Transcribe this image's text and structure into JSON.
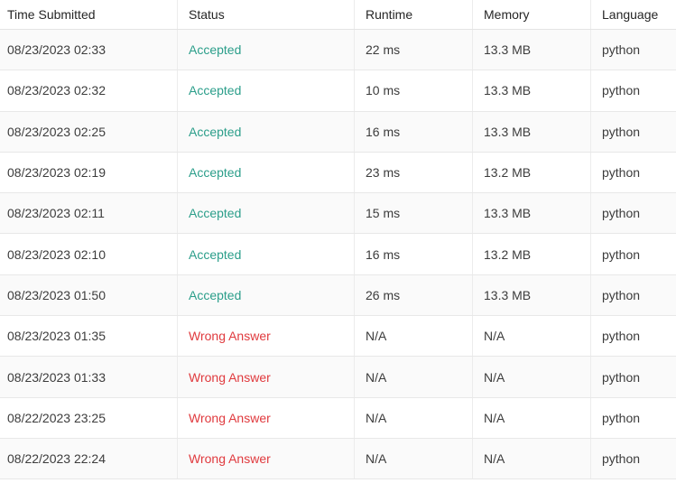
{
  "table": {
    "headers": {
      "time": "Time Submitted",
      "status": "Status",
      "runtime": "Runtime",
      "memory": "Memory",
      "language": "Language"
    },
    "rows": [
      {
        "time": "08/23/2023 02:33",
        "status": "Accepted",
        "runtime": "22 ms",
        "memory": "13.3 MB",
        "language": "python"
      },
      {
        "time": "08/23/2023 02:32",
        "status": "Accepted",
        "runtime": "10 ms",
        "memory": "13.3 MB",
        "language": "python"
      },
      {
        "time": "08/23/2023 02:25",
        "status": "Accepted",
        "runtime": "16 ms",
        "memory": "13.3 MB",
        "language": "python"
      },
      {
        "time": "08/23/2023 02:19",
        "status": "Accepted",
        "runtime": "23 ms",
        "memory": "13.2 MB",
        "language": "python"
      },
      {
        "time": "08/23/2023 02:11",
        "status": "Accepted",
        "runtime": "15 ms",
        "memory": "13.3 MB",
        "language": "python"
      },
      {
        "time": "08/23/2023 02:10",
        "status": "Accepted",
        "runtime": "16 ms",
        "memory": "13.2 MB",
        "language": "python"
      },
      {
        "time": "08/23/2023 01:50",
        "status": "Accepted",
        "runtime": "26 ms",
        "memory": "13.3 MB",
        "language": "python"
      },
      {
        "time": "08/23/2023 01:35",
        "status": "Wrong Answer",
        "runtime": "N/A",
        "memory": "N/A",
        "language": "python"
      },
      {
        "time": "08/23/2023 01:33",
        "status": "Wrong Answer",
        "runtime": "N/A",
        "memory": "N/A",
        "language": "python"
      },
      {
        "time": "08/22/2023 23:25",
        "status": "Wrong Answer",
        "runtime": "N/A",
        "memory": "N/A",
        "language": "python"
      },
      {
        "time": "08/22/2023 22:24",
        "status": "Wrong Answer",
        "runtime": "N/A",
        "memory": "N/A",
        "language": "python"
      }
    ]
  },
  "colors": {
    "accepted": "#2b9e8a",
    "wrong_answer": "#e03a3e"
  }
}
